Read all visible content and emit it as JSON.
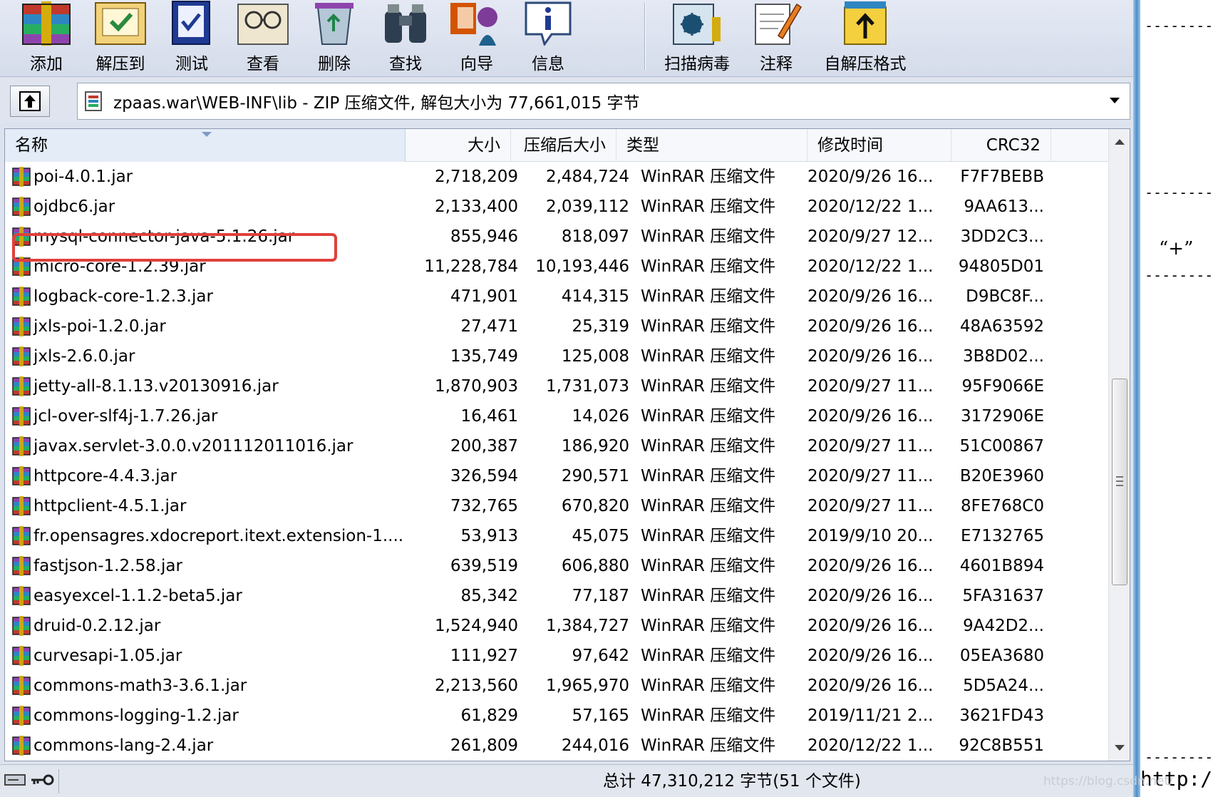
{
  "toolbar": {
    "buttons": [
      {
        "id": "add",
        "label": "添加",
        "icon": "archive-books-icon"
      },
      {
        "id": "extract",
        "label": "解压到",
        "icon": "extract-folder-icon"
      },
      {
        "id": "test",
        "label": "测试",
        "icon": "test-check-icon"
      },
      {
        "id": "view",
        "label": "查看",
        "icon": "glasses-book-icon"
      },
      {
        "id": "delete",
        "label": "删除",
        "icon": "recycle-bin-icon"
      },
      {
        "id": "find",
        "label": "查找",
        "icon": "binoculars-icon"
      },
      {
        "id": "wizard",
        "label": "向导",
        "icon": "wizard-icon"
      },
      {
        "id": "info",
        "label": "信息",
        "icon": "info-icon"
      },
      {
        "id": "scan",
        "label": "扫描病毒",
        "icon": "virus-scan-icon"
      },
      {
        "id": "comment",
        "label": "注释",
        "icon": "comment-pencil-icon"
      },
      {
        "id": "sfx",
        "label": "自解压格式",
        "icon": "sfx-archive-icon"
      }
    ]
  },
  "address": {
    "path": "zpaas.war\\WEB-INF\\lib - ZIP 压缩文件, 解包大小为 77,661,015 字节"
  },
  "columns": {
    "name": "名称",
    "size": "大小",
    "packed": "压缩后大小",
    "type": "类型",
    "modified": "修改时间",
    "crc": "CRC32"
  },
  "files": [
    {
      "name": "poi-4.0.1.jar",
      "size": "2,718,209",
      "packed": "2,484,724",
      "type": "WinRAR 压缩文件",
      "modified": "2020/9/26 16...",
      "crc": "F7F7BEBB"
    },
    {
      "name": "ojdbc6.jar",
      "size": "2,133,400",
      "packed": "2,039,112",
      "type": "WinRAR 压缩文件",
      "modified": "2020/12/22 1...",
      "crc": "9AA613..."
    },
    {
      "name": "mysql-connector-java-5.1.26.jar",
      "size": "855,946",
      "packed": "818,097",
      "type": "WinRAR 压缩文件",
      "modified": "2020/9/27 12...",
      "crc": "3DD2C3..."
    },
    {
      "name": "micro-core-1.2.39.jar",
      "size": "11,228,784",
      "packed": "10,193,446",
      "type": "WinRAR 压缩文件",
      "modified": "2020/12/22 1...",
      "crc": "94805D01"
    },
    {
      "name": "logback-core-1.2.3.jar",
      "size": "471,901",
      "packed": "414,315",
      "type": "WinRAR 压缩文件",
      "modified": "2020/9/26 16...",
      "crc": "D9BC8F..."
    },
    {
      "name": "jxls-poi-1.2.0.jar",
      "size": "27,471",
      "packed": "25,319",
      "type": "WinRAR 压缩文件",
      "modified": "2020/9/26 16...",
      "crc": "48A63592"
    },
    {
      "name": "jxls-2.6.0.jar",
      "size": "135,749",
      "packed": "125,008",
      "type": "WinRAR 压缩文件",
      "modified": "2020/9/26 16...",
      "crc": "3B8D02..."
    },
    {
      "name": "jetty-all-8.1.13.v20130916.jar",
      "size": "1,870,903",
      "packed": "1,731,073",
      "type": "WinRAR 压缩文件",
      "modified": "2020/9/27 11...",
      "crc": "95F9066E"
    },
    {
      "name": "jcl-over-slf4j-1.7.26.jar",
      "size": "16,461",
      "packed": "14,026",
      "type": "WinRAR 压缩文件",
      "modified": "2020/9/26 16...",
      "crc": "3172906E"
    },
    {
      "name": "javax.servlet-3.0.0.v201112011016.jar",
      "size": "200,387",
      "packed": "186,920",
      "type": "WinRAR 压缩文件",
      "modified": "2020/9/27 11...",
      "crc": "51C00867"
    },
    {
      "name": "httpcore-4.4.3.jar",
      "size": "326,594",
      "packed": "290,571",
      "type": "WinRAR 压缩文件",
      "modified": "2020/9/27 11...",
      "crc": "B20E3960"
    },
    {
      "name": "httpclient-4.5.1.jar",
      "size": "732,765",
      "packed": "670,820",
      "type": "WinRAR 压缩文件",
      "modified": "2020/9/27 11...",
      "crc": "8FE768C0"
    },
    {
      "name": "fr.opensagres.xdocreport.itext.extension-1....",
      "size": "53,913",
      "packed": "45,075",
      "type": "WinRAR 压缩文件",
      "modified": "2019/9/10 20...",
      "crc": "E7132765"
    },
    {
      "name": "fastjson-1.2.58.jar",
      "size": "639,519",
      "packed": "606,880",
      "type": "WinRAR 压缩文件",
      "modified": "2020/9/26 16...",
      "crc": "4601B894"
    },
    {
      "name": "easyexcel-1.1.2-beta5.jar",
      "size": "85,342",
      "packed": "77,187",
      "type": "WinRAR 压缩文件",
      "modified": "2020/9/26 16...",
      "crc": "5FA31637"
    },
    {
      "name": "druid-0.2.12.jar",
      "size": "1,524,940",
      "packed": "1,384,727",
      "type": "WinRAR 压缩文件",
      "modified": "2020/9/26 16...",
      "crc": "9A42D2..."
    },
    {
      "name": "curvesapi-1.05.jar",
      "size": "111,927",
      "packed": "97,642",
      "type": "WinRAR 压缩文件",
      "modified": "2020/9/26 16...",
      "crc": "05EA3680"
    },
    {
      "name": "commons-math3-3.6.1.jar",
      "size": "2,213,560",
      "packed": "1,965,970",
      "type": "WinRAR 压缩文件",
      "modified": "2020/9/26 16...",
      "crc": "5D5A24..."
    },
    {
      "name": "commons-logging-1.2.jar",
      "size": "61,829",
      "packed": "57,165",
      "type": "WinRAR 压缩文件",
      "modified": "2019/11/21 2...",
      "crc": "3621FD43"
    },
    {
      "name": "commons-lang-2.4.jar",
      "size": "261,809",
      "packed": "244,016",
      "type": "WinRAR 压缩文件",
      "modified": "2020/12/22 1...",
      "crc": "92C8B551"
    }
  ],
  "status": {
    "text": "总计 47,310,212 字节(51 个文件)"
  },
  "background": {
    "plus_text": "“+”",
    "http_text": "http:/",
    "watermark": "https://blog.csdn.net/"
  },
  "colors": {
    "highlight_border": "#e0403a",
    "header_selected": "#e3ecf7",
    "window_border": "#4b8ec8"
  }
}
